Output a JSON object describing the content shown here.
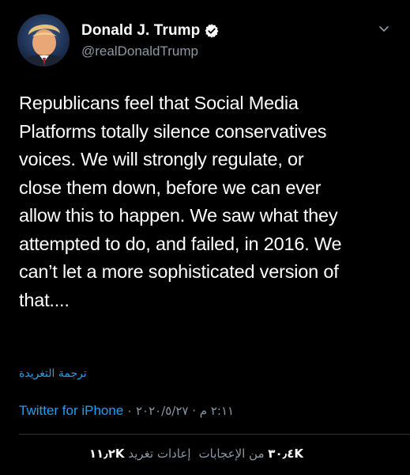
{
  "author": {
    "display_name": "Donald J. Trump",
    "handle": "@realDonaldTrump",
    "verified": true
  },
  "icons": {
    "verified": "verified-badge-icon",
    "more": "chevron-down-icon"
  },
  "tweet": {
    "text": "Republicans feel that Social Media\nPlatforms totally silence conservatives\nvoices. We will strongly regulate, or\nclose them down, before we can ever\nallow this to happen. We saw what they\nattempted to do, and failed, in 2016. We\ncan’t let a more sophisticated version of\nthat....",
    "translate_label": "ترجمة التغريدة",
    "source": "Twitter for iPhone",
    "separator": "·",
    "datetime": "٢:١١ م · ٢٠٢٠/٥/٢٧"
  },
  "stats": {
    "likes_count": "٣٠٫٤K",
    "likes_label": "من الإعجابات",
    "retweets_count": "١١٫٢K",
    "retweets_label": "إعادات تغريد"
  },
  "colors": {
    "background": "#000000",
    "text": "#ffffff",
    "secondary": "#8b98a5",
    "accent": "#1da1f2"
  }
}
